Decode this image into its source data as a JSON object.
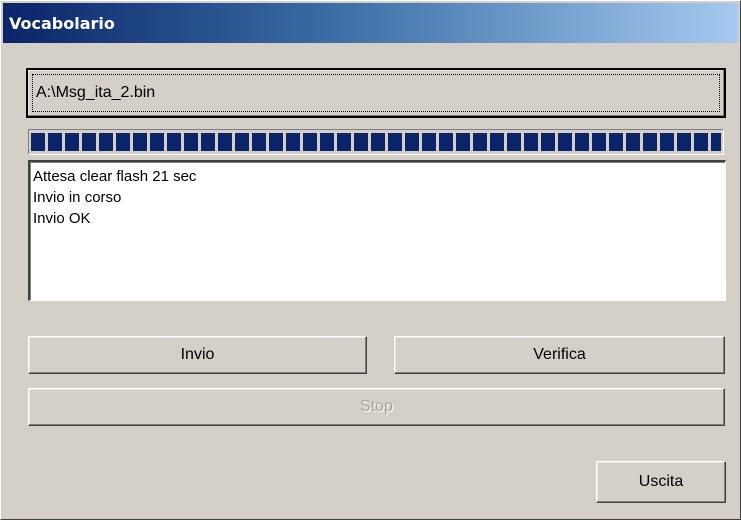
{
  "window": {
    "title": "Vocabolario"
  },
  "file": {
    "path": "A:\\Msg_ita_2.bin"
  },
  "progress": {
    "value": 1.0
  },
  "log": {
    "lines": [
      "Attesa clear flash 21 sec",
      "Invio in corso",
      "Invio OK"
    ]
  },
  "buttons": {
    "invio": "Invio",
    "verifica": "Verifica",
    "stop": "Stop",
    "uscita": "Uscita"
  }
}
